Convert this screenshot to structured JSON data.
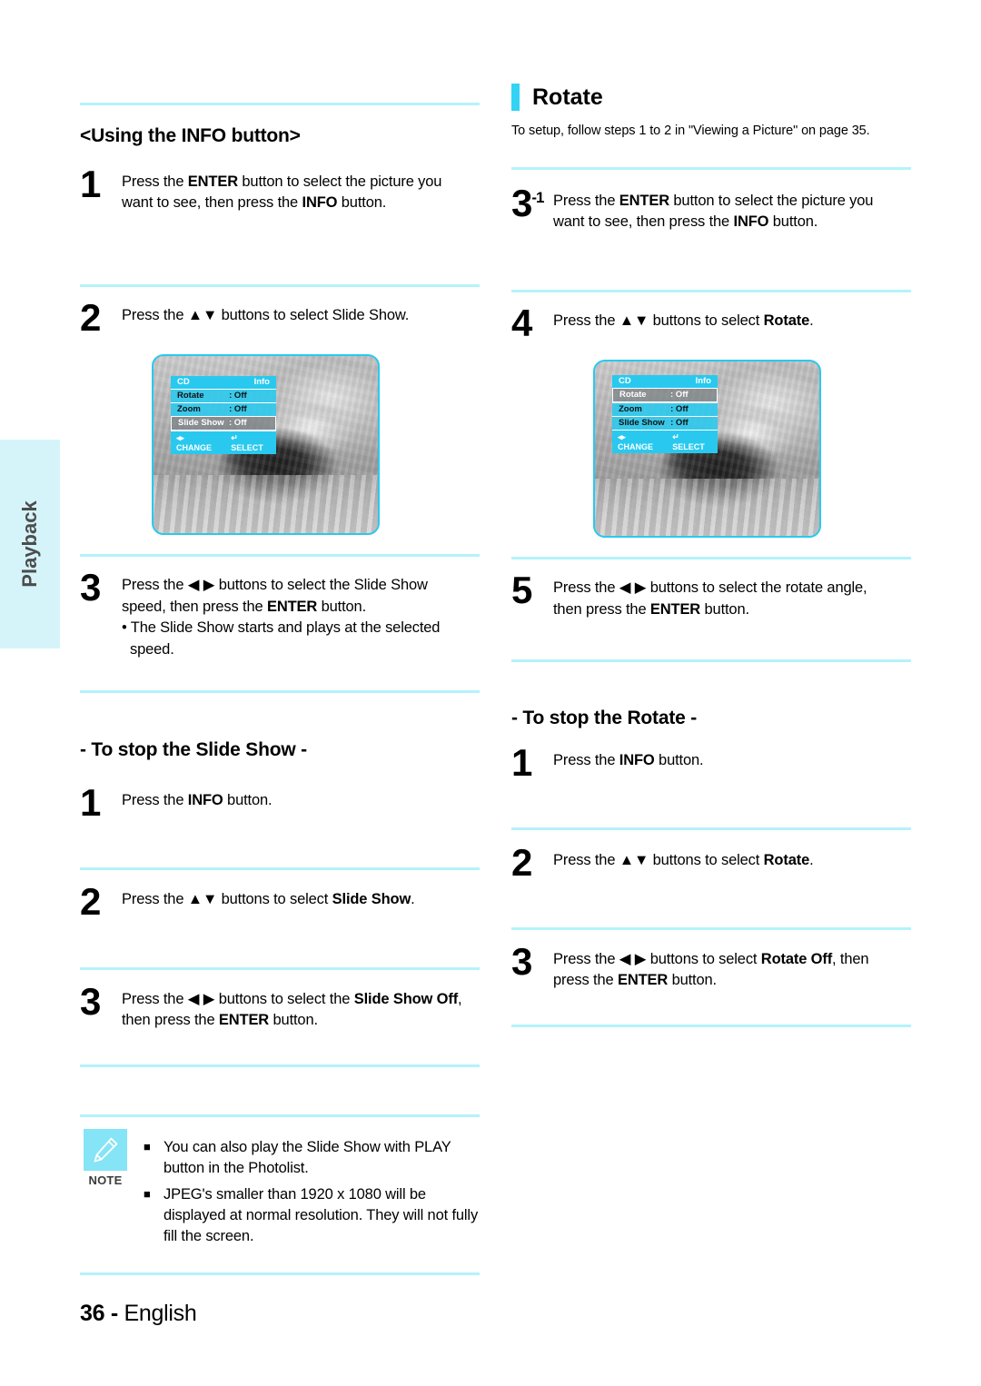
{
  "sidebar": {
    "tab_label": "Playback"
  },
  "footer": {
    "page_number": "36",
    "separator": "-",
    "language": "English"
  },
  "left_column": {
    "heading": "<Using the INFO button>",
    "steps": [
      {
        "num": "1",
        "line1_a": "Press the ",
        "line1_b": "ENTER",
        "line1_c": " button to select the picture you",
        "line2_a": "want to see, then press the ",
        "line2_b": "INFO",
        "line2_c": " button."
      },
      {
        "num": "2",
        "text_a": "Press the ",
        "arrows": "▲▼",
        "text_b": " buttons to select Slide Show."
      },
      {
        "num": "3",
        "text_a": "Press the ",
        "arrows": "◀ ▶",
        "text_b": " buttons to select the Slide Show",
        "line2_a": "speed, then press the ",
        "line2_b": "ENTER",
        "line2_c": " button.",
        "bullet": "• The Slide Show starts and plays at the selected speed."
      }
    ],
    "stop_section": {
      "title": "- To stop the Slide Show -",
      "steps": [
        {
          "num": "1",
          "text_a": "Press the ",
          "bold": "INFO",
          "text_b": " button."
        },
        {
          "num": "2",
          "text_a": "Press the ",
          "arrows": "▲▼",
          "text_b": " buttons to select ",
          "bold": "Slide Show",
          "text_c": "."
        },
        {
          "num": "3",
          "text_a": "Press the ",
          "arrows": "◀ ▶",
          "text_b": " buttons to select the ",
          "bold": "Slide Show Off",
          "text_c": ",",
          "line2_a": "then press the ",
          "line2_b": "ENTER",
          "line2_c": " button."
        }
      ]
    },
    "note": {
      "label": "NOTE",
      "icon": "pencil-icon",
      "items": [
        "You can also play the Slide Show with PLAY button in the Photolist.",
        "JPEG's smaller than 1920 x 1080 will be displayed at normal resolution. They will not fully fill the screen."
      ]
    },
    "osd": {
      "header_left": "CD",
      "header_right": "Info",
      "rows": [
        {
          "label": "Rotate",
          "value": ": Off",
          "selected": false
        },
        {
          "label": "Zoom",
          "value": ": Off",
          "selected": false
        },
        {
          "label": "Slide Show",
          "value": ": Off",
          "selected": true
        }
      ],
      "footer_change_icon": "◂▸",
      "footer_change": "CHANGE",
      "footer_select_icon": "↵",
      "footer_select": "SELECT"
    }
  },
  "right_column": {
    "chapter_title": "Rotate",
    "chapter_sub": "To setup, follow steps 1 to 2 in \"Viewing a Picture\" on page 35.",
    "steps": [
      {
        "num": "3",
        "sup": "-1",
        "line1_a": "Press the ",
        "line1_b": "ENTER",
        "line1_c": " button to select the picture you",
        "line2_a": "want to see, then press the ",
        "line2_b": "INFO",
        "line2_c": " button."
      },
      {
        "num": "4",
        "text_a": "Press the ",
        "arrows": "▲▼",
        "text_b": " buttons to select ",
        "bold": "Rotate",
        "text_c": "."
      },
      {
        "num": "5",
        "text_a": "Press the ",
        "arrows": "◀ ▶",
        "text_b": " buttons to select the rotate angle,",
        "line2_a": "then press the ",
        "line2_b": "ENTER",
        "line2_c": " button."
      }
    ],
    "stop_section": {
      "title": "- To stop the Rotate -",
      "steps": [
        {
          "num": "1",
          "text_a": "Press the ",
          "bold": "INFO",
          "text_b": " button."
        },
        {
          "num": "2",
          "text_a": "Press the ",
          "arrows": "▲▼",
          "text_b": " buttons to select ",
          "bold": "Rotate",
          "text_c": "."
        },
        {
          "num": "3",
          "text_a": "Press the ",
          "arrows": "◀ ▶",
          "text_b": " buttons to select ",
          "bold": "Rotate Off",
          "text_c": ", then",
          "line2_a": "press the ",
          "line2_b": "ENTER",
          "line2_c": " button."
        }
      ]
    },
    "osd": {
      "header_left": "CD",
      "header_right": "Info",
      "rows": [
        {
          "label": "Rotate",
          "value": ": Off",
          "selected": true
        },
        {
          "label": "Zoom",
          "value": ": Off",
          "selected": false
        },
        {
          "label": "Slide Show",
          "value": ": Off",
          "selected": false
        }
      ],
      "footer_change_icon": "◂▸",
      "footer_change": "CHANGE",
      "footer_select_icon": "↵",
      "footer_select": "SELECT"
    }
  },
  "colors": {
    "accent_cyan": "#33d3f5",
    "rule_cyan": "#b4f3fa",
    "tab_cyan": "#d5f4fa",
    "note_cyan": "#85e4f5"
  }
}
